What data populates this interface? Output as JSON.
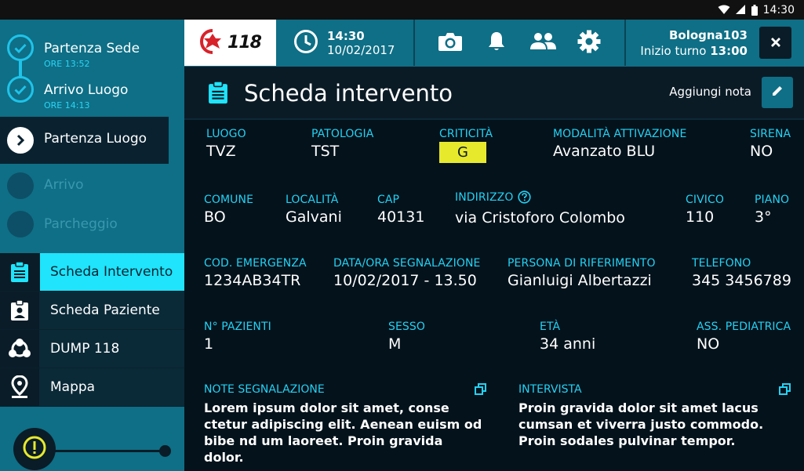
{
  "status_bar": {
    "time": "14:30",
    "icons": [
      "wifi-icon",
      "signal-icon",
      "battery-icon"
    ]
  },
  "timeline": {
    "steps": [
      {
        "title": "Partenza Sede",
        "time": "ORE 13:52",
        "state": "done"
      },
      {
        "title": "Arrivo Luogo",
        "time": "ORE 14:13",
        "state": "done"
      },
      {
        "title": "Partenza Luogo",
        "time": "",
        "state": "current"
      },
      {
        "title": "Arrivo",
        "time": "",
        "state": "future"
      },
      {
        "title": "Parcheggio",
        "time": "",
        "state": "future"
      }
    ]
  },
  "menu": {
    "items": [
      {
        "label": "Scheda Intervento",
        "icon": "clipboard-icon",
        "active": true
      },
      {
        "label": "Scheda Paziente",
        "icon": "patient-badge-icon",
        "active": false
      },
      {
        "label": "DUMP 118",
        "icon": "network-icon",
        "active": false
      },
      {
        "label": "Mappa",
        "icon": "map-pin-icon",
        "active": false
      }
    ]
  },
  "header": {
    "logo_text": "118",
    "time": "14:30",
    "date": "10/02/2017",
    "icons": [
      "camera-icon",
      "bell-icon",
      "people-icon",
      "gear-icon"
    ],
    "unit_name": "Bologna103",
    "shift_label": "Inizio turno",
    "shift_time": "13:00"
  },
  "page": {
    "title": "Scheda intervento",
    "add_note_label": "Aggiungi nota"
  },
  "fields": {
    "luogo": {
      "label": "LUOGO",
      "value": "TVZ"
    },
    "patologia": {
      "label": "PATOLOGIA",
      "value": "TST"
    },
    "criticita": {
      "label": "CRITICITÀ",
      "value": "G"
    },
    "modalita": {
      "label": "MODALITÀ ATTIVAZIONE",
      "value": "Avanzato BLU"
    },
    "sirena": {
      "label": "SIRENA",
      "value": "NO"
    },
    "comune": {
      "label": "COMUNE",
      "value": "BO"
    },
    "localita": {
      "label": "LOCALITÀ",
      "value": "Galvani"
    },
    "cap": {
      "label": "CAP",
      "value": "40131"
    },
    "indirizzo": {
      "label": "INDIRIZZO",
      "value": "via Cristoforo Colombo"
    },
    "civico": {
      "label": "CIVICO",
      "value": "110"
    },
    "piano": {
      "label": "PIANO",
      "value": "3°"
    },
    "cod_emergenza": {
      "label": "COD. EMERGENZA",
      "value": "1234AB34TR"
    },
    "data_ora": {
      "label": "DATA/ORA SEGNALAZIONE",
      "value": "10/02/2017 - 13.50"
    },
    "persona": {
      "label": "PERSONA DI RIFERIMENTO",
      "value": "Gianluigi Albertazzi"
    },
    "telefono": {
      "label": "TELEFONO",
      "value": "345 3456789"
    },
    "n_pazienti": {
      "label": "N° PAZIENTI",
      "value": "1"
    },
    "sesso": {
      "label": "SESSO",
      "value": "M"
    },
    "eta": {
      "label": "ETÀ",
      "value": "34 anni"
    },
    "ass_pediatrica": {
      "label": "ASS. PEDIATRICA",
      "value": "NO"
    }
  },
  "notes": {
    "segnalazione": {
      "label": "NOTE SEGNALAZIONE",
      "text": "Lorem ipsum dolor sit amet, conse ctetur adipiscing elit. Aenean euism od bibe nd um laoreet. Proin gravida dolor."
    },
    "intervista": {
      "label": "INTERVISTA",
      "text": "Proin gravida dolor sit amet lacus cumsan et viverra justo commodo. Proin sodales pulvinar tempor."
    }
  },
  "colors": {
    "accent": "#1fe4fb",
    "label": "#23d2f4",
    "teal": "#0e6f86",
    "dark": "#04121b",
    "badge_yellow": "#e7e92c"
  }
}
